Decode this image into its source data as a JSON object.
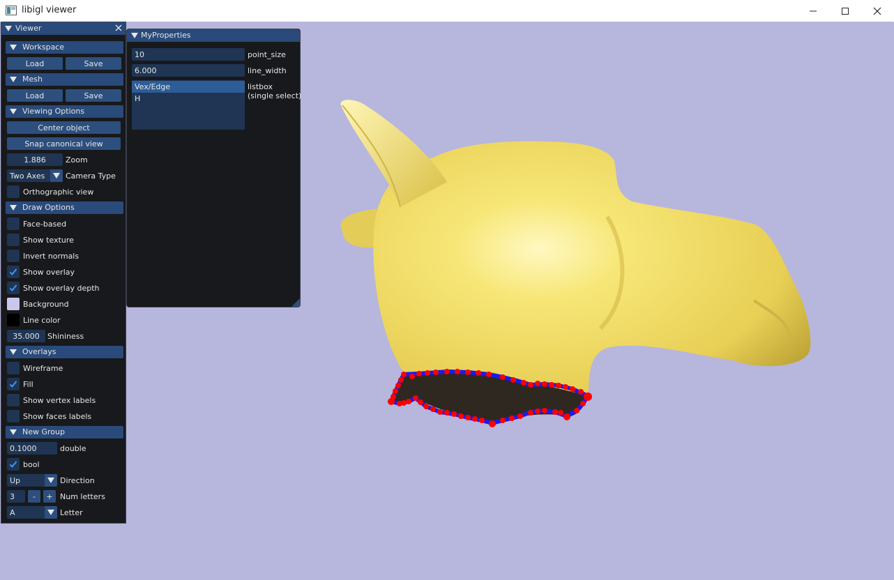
{
  "window": {
    "title": "libigl viewer"
  },
  "viewer_panel": {
    "title": "Viewer",
    "workspace": {
      "label": "Workspace",
      "load": "Load",
      "save": "Save"
    },
    "mesh": {
      "label": "Mesh",
      "load": "Load",
      "save": "Save"
    },
    "viewing_options": {
      "label": "Viewing Options",
      "center_object": "Center object",
      "snap_canonical_view": "Snap canonical view",
      "zoom_value": "1.886",
      "zoom_label": "Zoom",
      "camera_type_value": "Two Axes",
      "camera_type_label": "Camera Type",
      "orthographic_label": "Orthographic view",
      "orthographic_checked": false
    },
    "draw_options": {
      "label": "Draw Options",
      "face_based": "Face-based",
      "show_texture": "Show texture",
      "invert_normals": "Invert normals",
      "show_overlay": "Show overlay",
      "show_overlay_depth": "Show overlay depth",
      "background": "Background",
      "background_color": "#c9c8ea",
      "line_color": "Line color",
      "line_color_value": "#000000",
      "shininess_value": "35.000",
      "shininess_label": "Shininess"
    },
    "overlays": {
      "label": "Overlays",
      "wireframe": "Wireframe",
      "fill": "Fill",
      "show_vertex_labels": "Show vertex labels",
      "show_faces_labels": "Show faces labels"
    },
    "new_group": {
      "label": "New Group",
      "double_value": "0.1000",
      "double_label": "double",
      "bool_label": "bool",
      "direction_value": "Up",
      "direction_label": "Direction",
      "num_letters_value": "3",
      "minus": "-",
      "plus": "+",
      "num_letters_label": "Num letters",
      "letter_value": "A",
      "letter_label": "Letter"
    }
  },
  "properties_panel": {
    "title": "MyProperties",
    "point_size_value": "10",
    "point_size_label": "point_size",
    "line_width_value": "6.000",
    "line_width_label": "line_width",
    "listbox_items": [
      "Vex/Edge",
      "H"
    ],
    "listbox_label_1": "listbox",
    "listbox_label_2": "(single select)"
  },
  "scene": {
    "mesh_color": "#f2e06a",
    "overlay_point_color": "#ff0000",
    "overlay_line_color": "#1a1aee",
    "hole_color": "#2e2820"
  },
  "icons": [
    "app-icon",
    "minimize-icon",
    "maximize-icon",
    "close-icon",
    "collapse-triangle-icon",
    "checkmark-icon",
    "combo-arrow-icon",
    "resize-grip-icon"
  ]
}
